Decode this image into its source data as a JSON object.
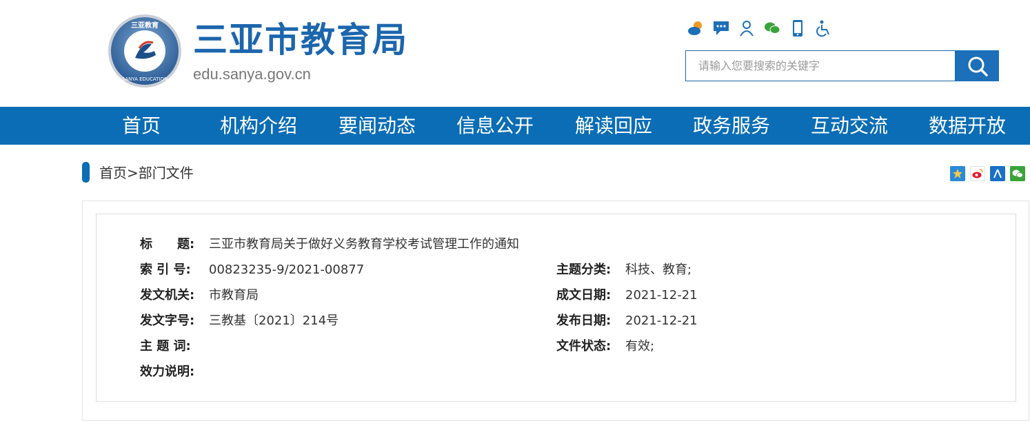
{
  "header": {
    "logo": {
      "ring_text": "三亚教育",
      "bottom_text": "SANYA EDUCATION"
    },
    "title": "三亚市教育局",
    "url": "edu.sanya.gov.cn",
    "icons": [
      "weather-icon",
      "message-icon",
      "user-icon",
      "wechat-icon",
      "mobile-icon",
      "accessibility-icon"
    ],
    "search": {
      "placeholder": "请输入您要搜索的关键字",
      "button_icon": "search-icon"
    }
  },
  "nav": {
    "items": [
      {
        "label": "首页"
      },
      {
        "label": "机构介绍"
      },
      {
        "label": "要闻动态"
      },
      {
        "label": "信息公开"
      },
      {
        "label": "解读回应"
      },
      {
        "label": "政务服务"
      },
      {
        "label": "互动交流"
      },
      {
        "label": "数据开放"
      }
    ]
  },
  "breadcrumb": {
    "home": "首页",
    "separator": ">",
    "current": "部门文件"
  },
  "share": [
    "qzone-share-icon",
    "weibo-share-icon",
    "renren-share-icon",
    "wechat-share-icon"
  ],
  "doc": {
    "title_label": "标　　题:",
    "title": "三亚市教育局关于做好义务教育学校考试管理工作的通知",
    "index_label": "索 引 号:",
    "index": "00823235-9/2021-00877",
    "topic_label": "主题分类:",
    "topic": "科技、教育;",
    "issuer_label": "发文机关:",
    "issuer": "市教育局",
    "created_label": "成文日期:",
    "created": "2021-12-21",
    "docno_label": "发文字号:",
    "docno": "三教基〔2021〕214号",
    "published_label": "发布日期:",
    "published": "2021-12-21",
    "keywords_label": "主 题 词:",
    "keywords": "",
    "status_label": "文件状态:",
    "status": "有效;",
    "effect_label": "效力说明:",
    "effect": ""
  },
  "colors": {
    "brand_blue": "#0b6db5",
    "title_blue": "#1c66ad"
  }
}
